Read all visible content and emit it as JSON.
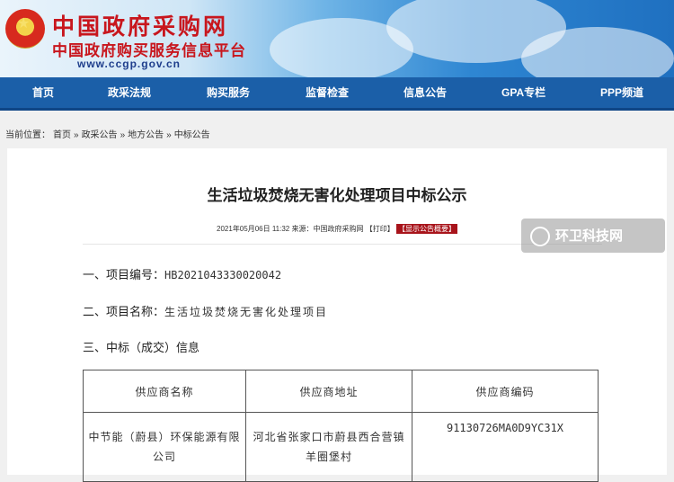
{
  "header": {
    "site_name": "中国政府采购网",
    "site_subtitle": "中国政府购买服务信息平台",
    "url": "www.ccgp.gov.cn"
  },
  "nav": [
    "首页",
    "政采法规",
    "购买服务",
    "监督检查",
    "信息公告",
    "GPA专栏",
    "PPP频道"
  ],
  "breadcrumb": {
    "prefix": "当前位置：",
    "items": [
      "首页",
      "»",
      "政采公告",
      "»",
      "地方公告",
      "»",
      "中标公告"
    ]
  },
  "article": {
    "title": "生活垃圾焚烧无害化处理项目中标公示",
    "date": "2021年05月06日 11:32",
    "source_label": "来源：",
    "source": "中国政府采购网",
    "print": "【打印】",
    "summary_button": "【显示公告概要】"
  },
  "watermark": "环卫科技网",
  "sections": {
    "project_no_label": "一、项目编号：",
    "project_no": "HB2021043330020042",
    "project_name_label": "二、项目名称：",
    "project_name": "生活垃圾焚烧无害化处理项目",
    "result_label": "三、中标（成交）信息"
  },
  "table": {
    "headers": [
      "供应商名称",
      "供应商地址",
      "供应商编码"
    ],
    "rows": [
      [
        "中节能（蔚县）环保能源有限公司",
        "河北省张家口市蔚县西合营镇羊圈堡村",
        "91130726MA0D9YC31X"
      ]
    ]
  },
  "colors": {
    "nav_bg": "#1b5fa8",
    "brand_red": "#c8161d",
    "badge_red": "#a8141b"
  }
}
